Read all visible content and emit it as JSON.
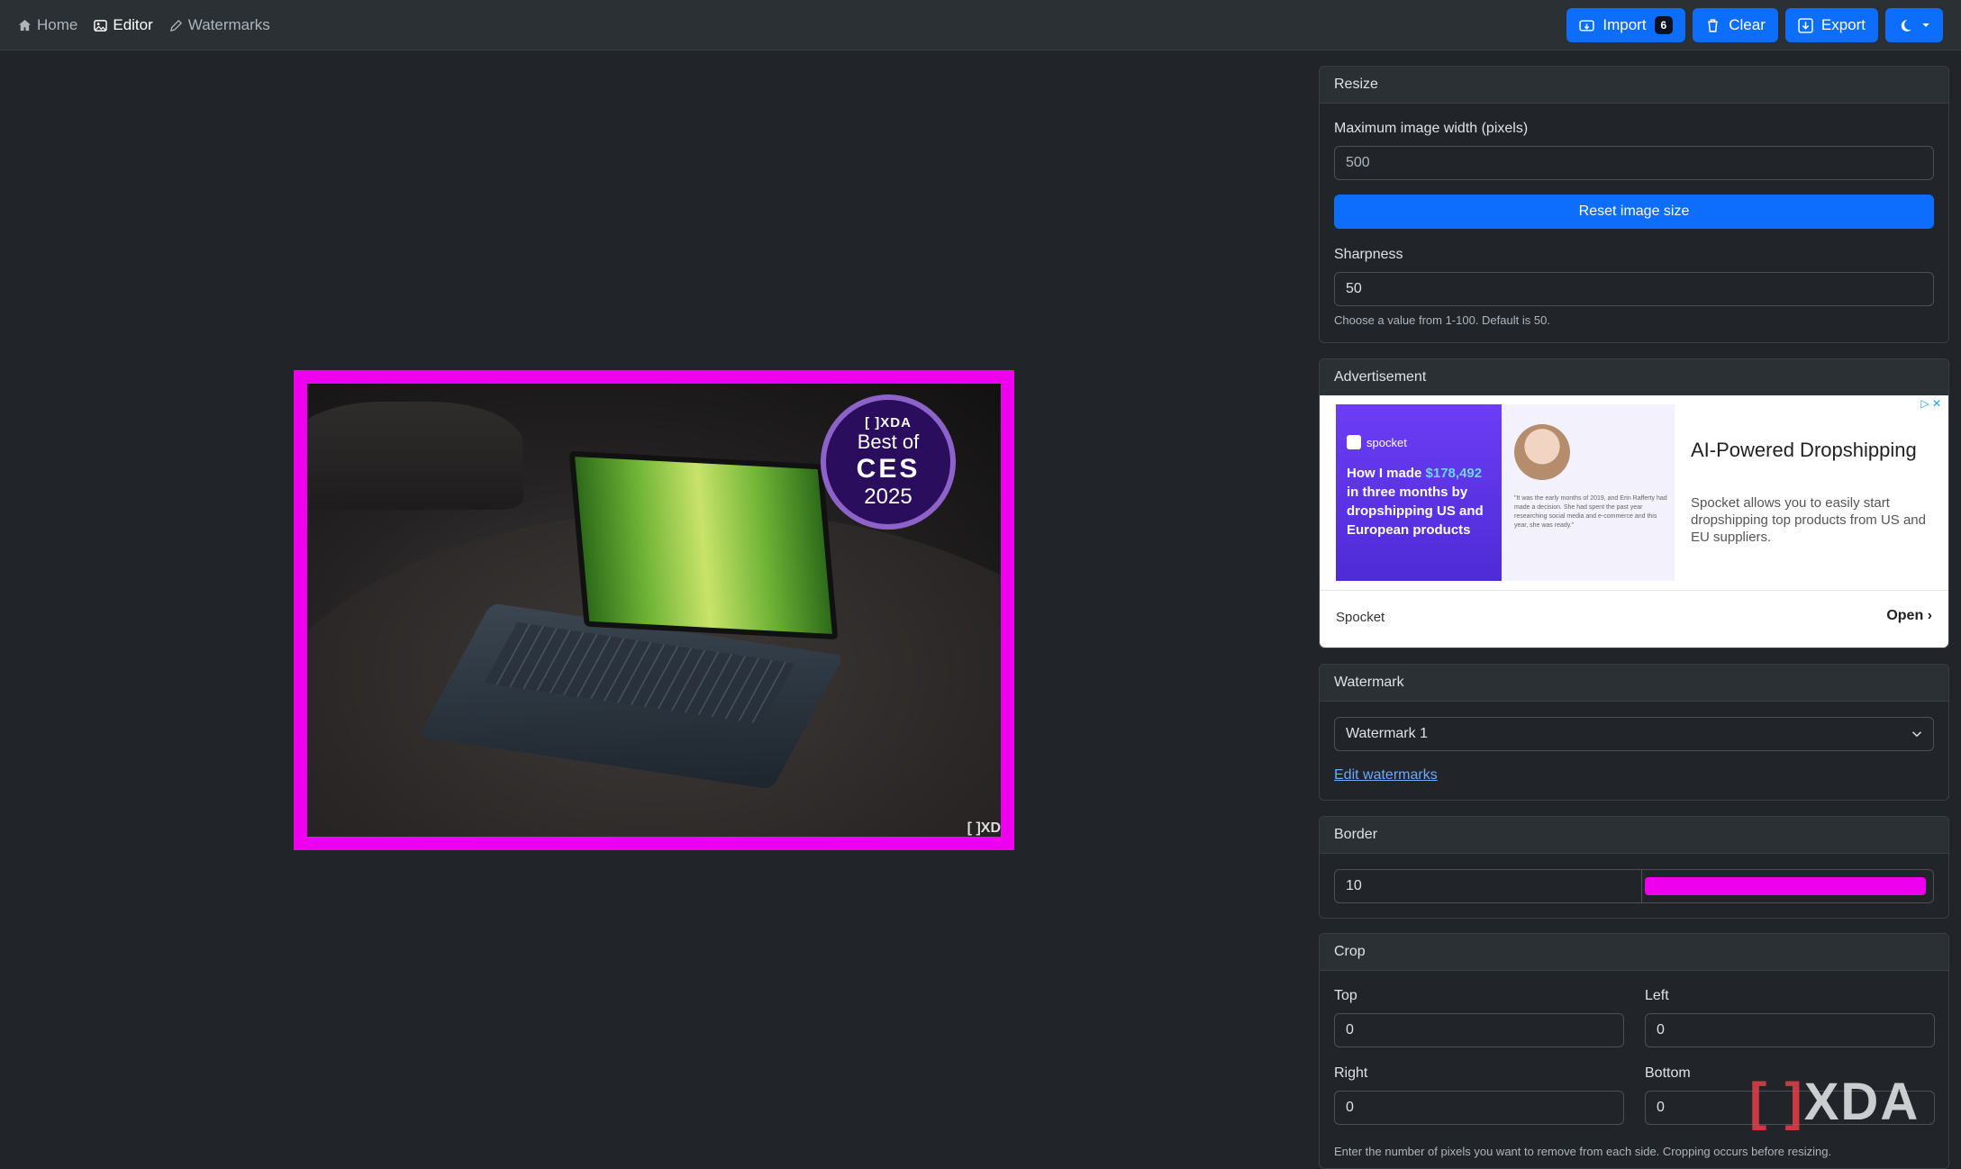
{
  "nav": {
    "home": "Home",
    "editor": "Editor",
    "watermarks": "Watermarks"
  },
  "toolbar": {
    "import_label": "Import",
    "import_count": "6",
    "clear_label": "Clear",
    "export_label": "Export"
  },
  "canvas": {
    "border_color": "#ee00ee",
    "badge": {
      "brand": "[ ]XDA",
      "line1": "Best of",
      "line2": "CES",
      "line3": "2025"
    },
    "corner_mark": "[ ]XD"
  },
  "resize": {
    "title": "Resize",
    "max_width_label": "Maximum image width (pixels)",
    "max_width_placeholder": "500",
    "reset_label": "Reset image size",
    "sharpness_label": "Sharpness",
    "sharpness_value": "50",
    "sharpness_help": "Choose a value from 1-100. Default is 50."
  },
  "ad": {
    "title": "Advertisement",
    "brand": "spocket",
    "headline_pre": "How I made ",
    "headline_amount": "$178,492",
    "headline_post": " in three months by dropshipping US and European products",
    "quote": "\"It was the early months of 2019, and Erin Rafferty had made a decision. She had spent the past year researching social media and e-commerce and this year, she was ready.\"",
    "ad_title": "AI-Powered Dropshipping",
    "ad_desc": "Spocket allows you to easily start dropshipping top products from US and EU suppliers.",
    "sponsor": "Spocket",
    "open_label": "Open"
  },
  "watermark": {
    "title": "Watermark",
    "selected": "Watermark 1",
    "edit_link": "Edit watermarks"
  },
  "border": {
    "title": "Border",
    "width_value": "10",
    "color": "#ee00ee"
  },
  "crop": {
    "title": "Crop",
    "top_label": "Top",
    "top_value": "0",
    "left_label": "Left",
    "left_value": "0",
    "right_label": "Right",
    "right_value": "0",
    "bottom_label": "Bottom",
    "bottom_value": "0",
    "help": "Enter the number of pixels you want to remove from each side. Cropping occurs before resizing."
  },
  "footer_logo": "XDA",
  "colors": {
    "accent": "#0d6efd",
    "background": "#212529",
    "panel_header": "#2b3035"
  }
}
